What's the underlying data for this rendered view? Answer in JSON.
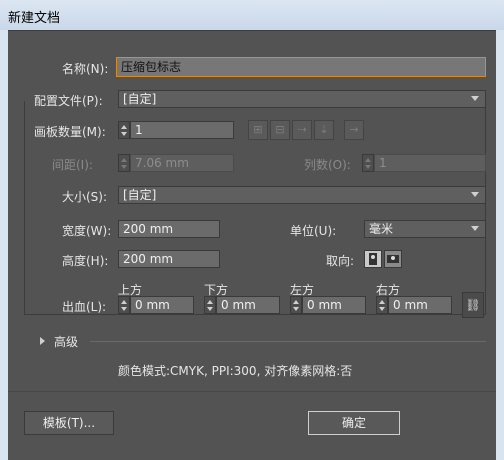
{
  "window": {
    "title": "新建文档"
  },
  "name": {
    "label": "名称(N):",
    "value": "压缩包标志"
  },
  "profile": {
    "label": "配置文件(P):",
    "value": "[自定]"
  },
  "artboards": {
    "count_label": "画板数量(M):",
    "count_value": "1",
    "layout_icons": [
      "grid-by-row-icon",
      "grid-by-column-icon",
      "arrange-by-row-icon",
      "arrange-by-column-icon",
      "right-to-left-icon"
    ],
    "spacing_label": "间距(I):",
    "spacing_value": "7.06 mm",
    "columns_label": "列数(O):",
    "columns_value": "1"
  },
  "size": {
    "label": "大小(S):",
    "value": "[自定]"
  },
  "width": {
    "label": "宽度(W):",
    "value": "200 mm"
  },
  "units": {
    "label": "单位(U):",
    "value": "毫米"
  },
  "height": {
    "label": "高度(H):",
    "value": "200 mm"
  },
  "orientation": {
    "label": "取向:",
    "options": [
      "portrait",
      "landscape"
    ],
    "selected": "portrait"
  },
  "bleed": {
    "label": "出血(L):",
    "top_label": "上方",
    "top_value": "0 mm",
    "bottom_label": "下方",
    "bottom_value": "0 mm",
    "left_label": "左方",
    "left_value": "0 mm",
    "right_label": "右方",
    "right_value": "0 mm"
  },
  "advanced": {
    "label": "高级",
    "summary": "颜色模式:CMYK, PPI:300, 对齐像素网格:否"
  },
  "buttons": {
    "templates": "模板(T)...",
    "ok": "确定"
  },
  "colors": {
    "dialog_bg": "#535353",
    "focus_border": "#d38b2b",
    "titlebar": "#dce6f2"
  }
}
